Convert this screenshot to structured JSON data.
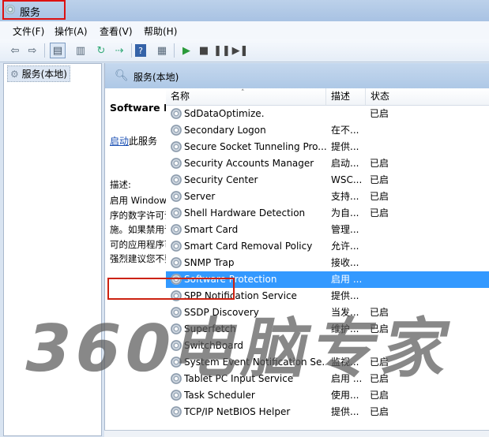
{
  "window": {
    "title": "服务"
  },
  "menu": [
    {
      "label": "文件(F)"
    },
    {
      "label": "操作(A)"
    },
    {
      "label": "查看(V)"
    },
    {
      "label": "帮助(H)"
    }
  ],
  "tree": {
    "root_label": "服务(本地)"
  },
  "main_header": {
    "title": "服务(本地)"
  },
  "description_pane": {
    "service_name": "Software Protection",
    "start_link": "启动",
    "start_suffix": "此服务",
    "desc_label": "描述:",
    "desc_lines": [
      "启用 Windows 和 Windows 应用程",
      "序的数字许可证的下载、安装和实",
      "施。如果禁用该服务，操作系统和许",
      "可的应用程序可能以通知模式运行。",
      "强烈建议您不要禁用软件保护服务。"
    ]
  },
  "list": {
    "columns": [
      "名称",
      "描述",
      "状态"
    ],
    "rows": [
      {
        "name": "SdDataOptimize.",
        "desc": "",
        "status": "已启"
      },
      {
        "name": "Secondary Logon",
        "desc": "在不...",
        "status": ""
      },
      {
        "name": "Secure Socket Tunneling Pro...",
        "desc": "提供...",
        "status": ""
      },
      {
        "name": "Security Accounts Manager",
        "desc": "启动...",
        "status": "已启"
      },
      {
        "name": "Security Center",
        "desc": "WSC...",
        "status": "已启"
      },
      {
        "name": "Server",
        "desc": "支持...",
        "status": "已启"
      },
      {
        "name": "Shell Hardware Detection",
        "desc": "为自...",
        "status": "已启"
      },
      {
        "name": "Smart Card",
        "desc": "管理...",
        "status": ""
      },
      {
        "name": "Smart Card Removal Policy",
        "desc": "允许...",
        "status": ""
      },
      {
        "name": "SNMP Trap",
        "desc": "接收...",
        "status": ""
      },
      {
        "name": "Software Protection",
        "desc": "启用 ...",
        "status": "",
        "selected": true
      },
      {
        "name": "SPP Notification Service",
        "desc": "提供...",
        "status": ""
      },
      {
        "name": "SSDP Discovery",
        "desc": "当发...",
        "status": "已启"
      },
      {
        "name": "Superfetch",
        "desc": "维护...",
        "status": "已启"
      },
      {
        "name": "SwitchBoard",
        "desc": "",
        "status": ""
      },
      {
        "name": "System Event Notification Se...",
        "desc": "监视...",
        "status": "已启"
      },
      {
        "name": "Tablet PC Input Service",
        "desc": "启用 ...",
        "status": "已启"
      },
      {
        "name": "Task Scheduler",
        "desc": "使用...",
        "status": "已启"
      },
      {
        "name": "TCP/IP NetBIOS Helper",
        "desc": "提供...",
        "status": "已启"
      }
    ]
  },
  "watermark": "360电脑专家",
  "colors": {
    "selection": "#3399ff",
    "highlight_box": "#cc2211",
    "link": "#1a4fb3"
  }
}
